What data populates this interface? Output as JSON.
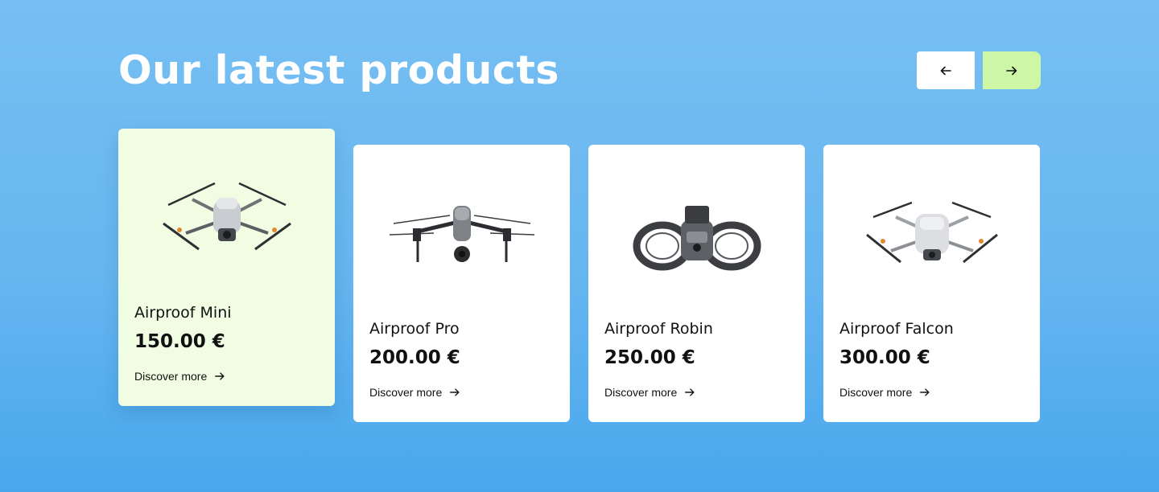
{
  "section": {
    "title": "Our latest products",
    "nav": {
      "prev_icon": "arrow-left-icon",
      "next_icon": "arrow-right-icon",
      "next_color": "#cdf7a4"
    }
  },
  "products": [
    {
      "name": "Airproof Mini",
      "price": "150.00 €",
      "link": "Discover more",
      "image": "drone-mini-image",
      "active": true
    },
    {
      "name": "Airproof Pro",
      "price": "200.00 €",
      "link": "Discover more",
      "image": "drone-pro-image",
      "active": false
    },
    {
      "name": "Airproof Robin",
      "price": "250.00 €",
      "link": "Discover more",
      "image": "drone-robin-image",
      "active": false
    },
    {
      "name": "Airproof Falcon",
      "price": "300.00 €",
      "link": "Discover more",
      "image": "drone-falcon-image",
      "active": false
    }
  ],
  "colors": {
    "background_top": "#76bff2",
    "background_bottom": "#48a7ec",
    "active_card": "#f0fde3",
    "card": "#ffffff"
  }
}
